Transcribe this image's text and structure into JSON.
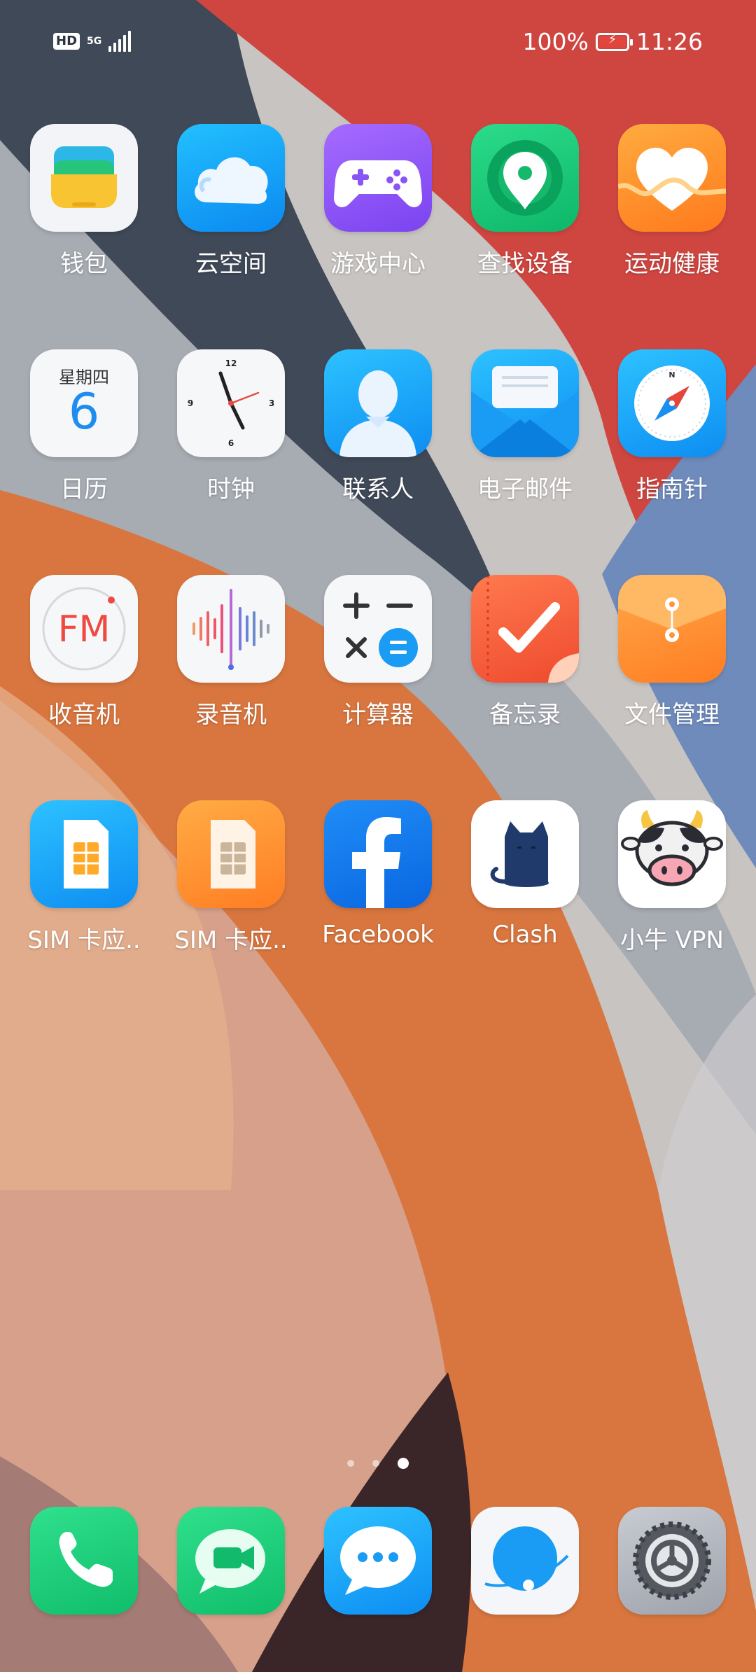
{
  "status_bar": {
    "hd": "HD",
    "network": "5G",
    "battery_pct": "100%",
    "time": "11:26"
  },
  "apps": [
    {
      "label": "钱包",
      "icon": "wallet-icon"
    },
    {
      "label": "云空间",
      "icon": "cloud-icon"
    },
    {
      "label": "游戏中心",
      "icon": "game-controller-icon"
    },
    {
      "label": "查找设备",
      "icon": "location-pin-icon"
    },
    {
      "label": "运动健康",
      "icon": "heart-icon"
    },
    {
      "label": "日历",
      "icon": "calendar-icon",
      "weekday": "星期四",
      "day": "6"
    },
    {
      "label": "时钟",
      "icon": "clock-icon"
    },
    {
      "label": "联系人",
      "icon": "contact-person-icon"
    },
    {
      "label": "电子邮件",
      "icon": "envelope-icon"
    },
    {
      "label": "指南针",
      "icon": "compass-icon"
    },
    {
      "label": "收音机",
      "icon": "fm-radio-icon",
      "text": "FM"
    },
    {
      "label": "录音机",
      "icon": "sound-wave-icon"
    },
    {
      "label": "计算器",
      "icon": "calculator-icon"
    },
    {
      "label": "备忘录",
      "icon": "checkmark-note-icon"
    },
    {
      "label": "文件管理",
      "icon": "folder-envelope-icon"
    },
    {
      "label": "SIM 卡应..",
      "icon": "sim-card-icon"
    },
    {
      "label": "SIM 卡应..",
      "icon": "sim-card-icon"
    },
    {
      "label": "Facebook",
      "icon": "facebook-icon"
    },
    {
      "label": "Clash",
      "icon": "cat-icon"
    },
    {
      "label": "小牛 VPN",
      "icon": "cow-icon"
    }
  ],
  "dock": [
    {
      "icon": "phone-icon"
    },
    {
      "icon": "video-chat-icon"
    },
    {
      "icon": "message-icon"
    },
    {
      "icon": "browser-globe-icon"
    },
    {
      "icon": "settings-gear-icon"
    }
  ],
  "page_indicator": {
    "count": 3,
    "active": 3
  },
  "colors": {
    "wall_red": "#d0453e",
    "wall_orange": "#db7a45",
    "wall_slate": "#4b5669",
    "wall_grey": "#a9aeb4",
    "wall_blue": "#6e8cbf"
  }
}
